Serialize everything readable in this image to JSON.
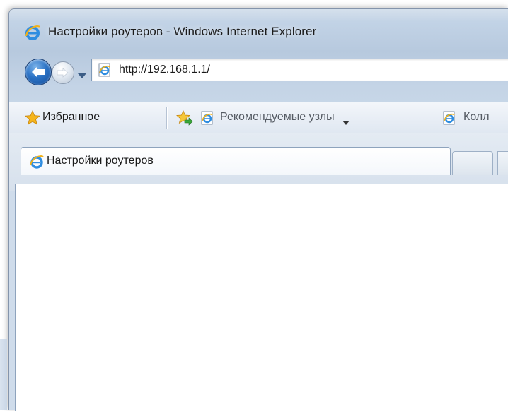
{
  "window": {
    "title": "Настройки роутеров - Windows Internet Explorer",
    "title_icon": "ie-icon"
  },
  "nav": {
    "back_icon": "back-arrow-icon",
    "forward_icon": "forward-arrow-icon",
    "history_icon": "chevron-down-icon",
    "address": "http://192.168.1.1/"
  },
  "favorites_bar": {
    "favorites_label": "Избранное",
    "suggested_sites_label": "Рекомендуемые узлы",
    "web_slice_label": "Колл"
  },
  "tabs": [
    {
      "label": "Настройки роутеров",
      "active": true
    }
  ],
  "colors": {
    "frame": "#c2d3e6",
    "accent": "#2c73c5",
    "star": "#f5b51c"
  }
}
